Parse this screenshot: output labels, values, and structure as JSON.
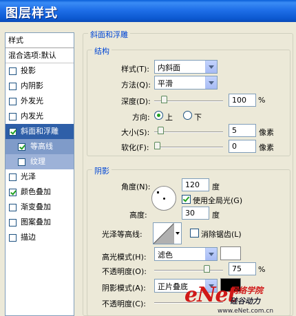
{
  "window": {
    "title": "图层样式"
  },
  "styles_list": {
    "header": "样式",
    "blend_options": "混合选项:默认",
    "items": [
      {
        "label": "投影",
        "checked": false,
        "state": ""
      },
      {
        "label": "内阴影",
        "checked": false,
        "state": ""
      },
      {
        "label": "外发光",
        "checked": false,
        "state": ""
      },
      {
        "label": "内发光",
        "checked": false,
        "state": ""
      },
      {
        "label": "斜面和浮雕",
        "checked": true,
        "state": "selected"
      },
      {
        "label": "等高线",
        "checked": true,
        "state": "sub-selected"
      },
      {
        "label": "纹理",
        "checked": false,
        "state": "sub"
      },
      {
        "label": "光泽",
        "checked": false,
        "state": ""
      },
      {
        "label": "颜色叠加",
        "checked": true,
        "state": ""
      },
      {
        "label": "渐变叠加",
        "checked": false,
        "state": ""
      },
      {
        "label": "图案叠加",
        "checked": false,
        "state": ""
      },
      {
        "label": "描边",
        "checked": false,
        "state": ""
      }
    ]
  },
  "bevel": {
    "group_title": "斜面和浮雕",
    "structure_title": "结构",
    "style_label": "样式(T):",
    "style_value": "内斜面",
    "technique_label": "方法(Q):",
    "technique_value": "平滑",
    "depth_label": "深度(D):",
    "depth_value": "100",
    "depth_unit": "%",
    "direction_label": "方向:",
    "direction_up": "上",
    "direction_down": "下",
    "size_label": "大小(S):",
    "size_value": "5",
    "size_unit": "像素",
    "soften_label": "软化(F):",
    "soften_value": "0",
    "soften_unit": "像素"
  },
  "shading": {
    "title": "阴影",
    "angle_label": "角度(N):",
    "angle_value": "120",
    "angle_unit": "度",
    "global_light_label": "使用全局光(G)",
    "global_light_checked": true,
    "altitude_label": "高度:",
    "altitude_value": "30",
    "altitude_unit": "度",
    "gloss_contour_label": "光泽等高线:",
    "anti_alias_label": "消除锯齿(L)",
    "anti_alias_checked": false,
    "highlight_mode_label": "高光模式(H):",
    "highlight_mode_value": "滤色",
    "highlight_color": "#ffffff",
    "highlight_opacity_label": "不透明度(O):",
    "highlight_opacity_value": "75",
    "highlight_opacity_unit": "%",
    "shadow_mode_label": "阴影模式(A):",
    "shadow_mode_value": "正片叠底",
    "shadow_color": "#000000",
    "shadow_opacity_label": "不透明度(C):"
  },
  "watermark": {
    "logo": "eNet",
    "line1": "网络学院",
    "line2": "硅谷动力",
    "url": "www.eNet.com.cn"
  },
  "colors": {
    "titlebar": "#1f6fe8",
    "accent": "#0046d5",
    "selected_row": "#2e5fa8"
  }
}
